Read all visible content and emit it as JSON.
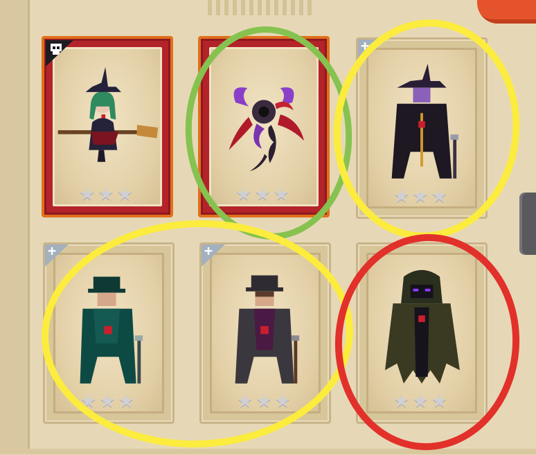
{
  "cards": [
    {
      "id": "card-witch",
      "type": "elite",
      "badge": "skull",
      "stars": "★★★",
      "art": "witch-on-broom"
    },
    {
      "id": "card-demon",
      "type": "elite",
      "badge": "none",
      "stars": "★★★",
      "art": "purple-tentacle-demon"
    },
    {
      "id": "card-purple-hat-cultist",
      "type": "normal",
      "badge": "plus",
      "stars": "★★★",
      "art": "cultist-purple-witch-hat"
    },
    {
      "id": "card-green-bowler-gent",
      "type": "normal",
      "badge": "plus",
      "stars": "★★★",
      "art": "gentleman-green-bowler"
    },
    {
      "id": "card-grey-bowler-gent",
      "type": "normal",
      "badge": "plus",
      "stars": "★★★",
      "art": "gentleman-grey-bowler"
    },
    {
      "id": "card-hooded-shadow",
      "type": "normal",
      "badge": "none",
      "stars": "★★★",
      "art": "hooded-shadow-purple-eyes"
    }
  ],
  "badges": {
    "plus_symbol": "+"
  },
  "annotations": [
    {
      "color": "#86c24f",
      "label": "green circle"
    },
    {
      "color": "#fcec3e",
      "label": "yellow circle"
    },
    {
      "color": "#fcec3e",
      "label": "yellow circle"
    },
    {
      "color": "#e2302b",
      "label": "red circle"
    }
  ],
  "colors": {
    "elite_border": "#e0701c",
    "elite_fill": "#b3232a",
    "parchment": "#e2cfa6",
    "accent_orange": "#e4532b"
  }
}
